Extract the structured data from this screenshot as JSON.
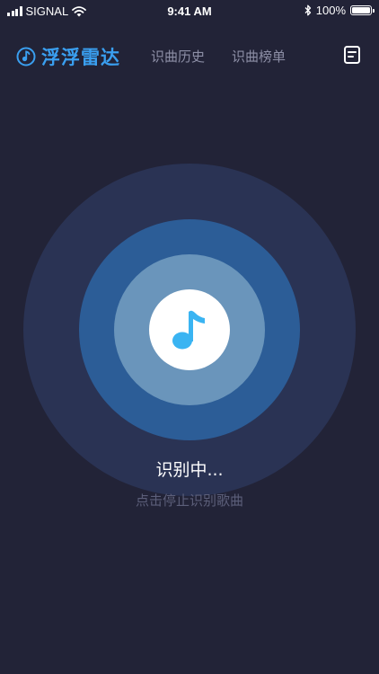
{
  "status_bar": {
    "carrier": "SIGNAL",
    "time": "9:41 AM",
    "battery": "100%",
    "battery_level": 1.0,
    "icons": [
      "signal-icon",
      "wifi-icon",
      "bluetooth-icon",
      "battery-icon"
    ]
  },
  "header": {
    "title": "浮浮雷达",
    "logo_icon": "music-note-circle-icon",
    "nav": [
      {
        "label": "识曲历史"
      },
      {
        "label": "识曲榜单"
      }
    ],
    "menu_icon": "document-list-icon"
  },
  "radar": {
    "center_icon": "music-note-icon",
    "status": "识别中...",
    "hint": "点击停止识别歌曲"
  },
  "colors": {
    "background": "#222337",
    "accent": "#3a9ff0",
    "ring_outer": "#2a3354",
    "ring_mid": "#2c5d97",
    "ring_inner": "#6a95bb",
    "note": "#3ab4f2",
    "muted_text": "#5c5f7a",
    "nav_text": "#8d8fa6"
  }
}
